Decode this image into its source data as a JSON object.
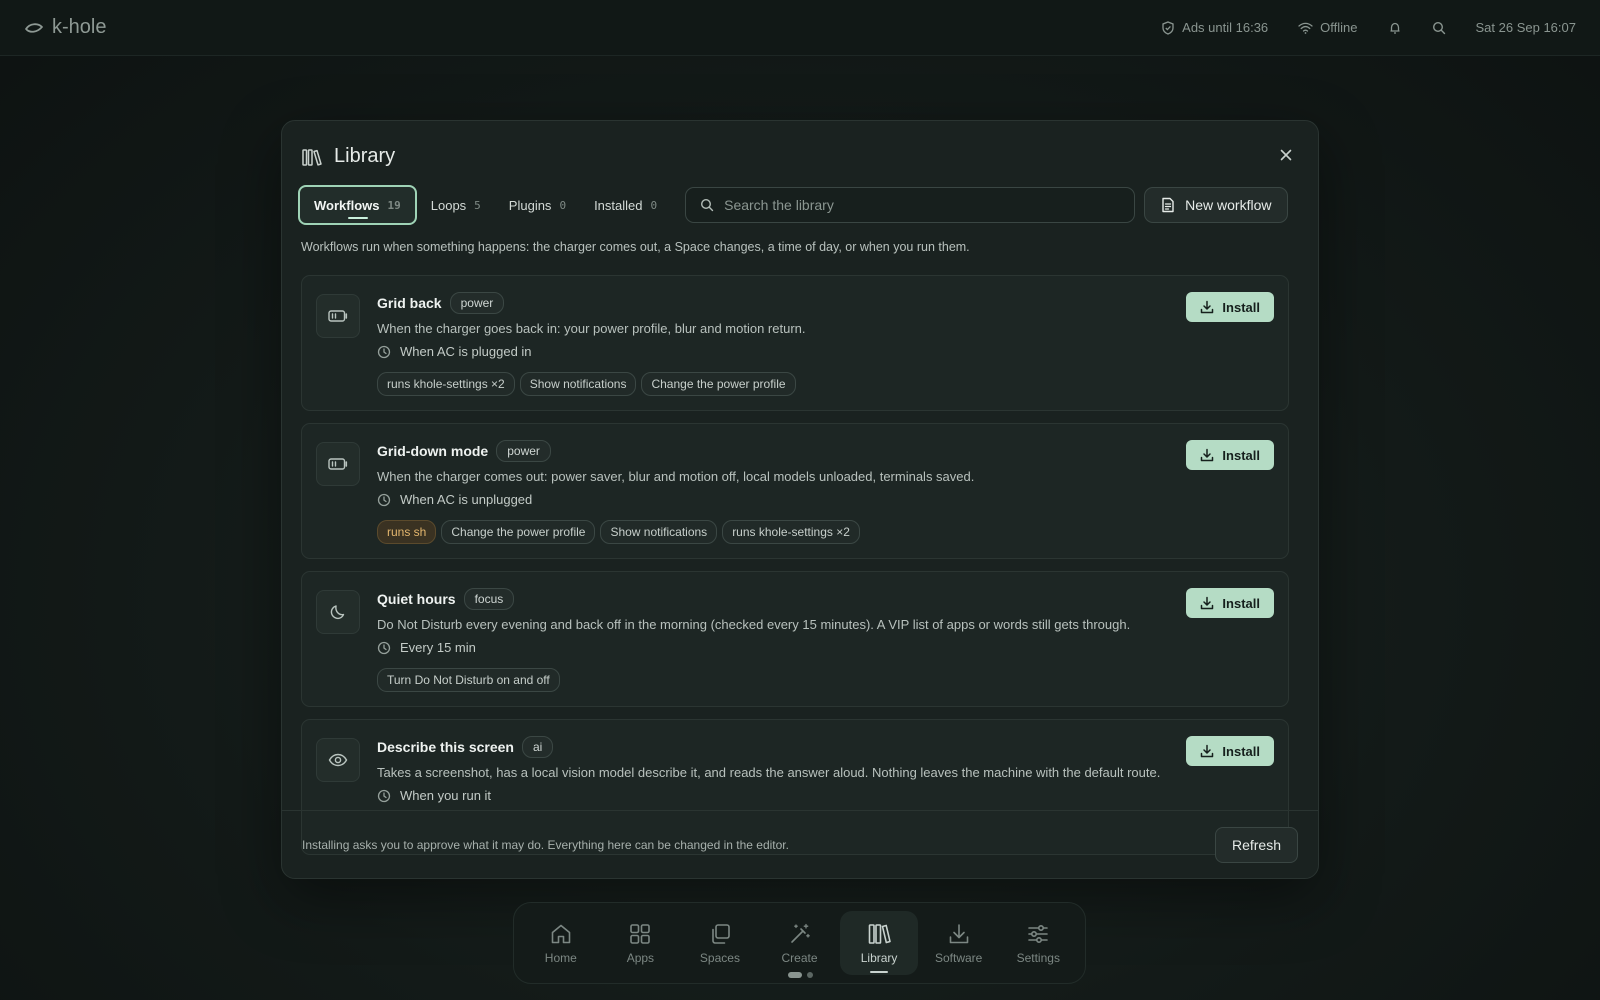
{
  "topbar": {
    "brand": "k-hole",
    "ads": "Ads until 16:36",
    "network": "Offline",
    "datetime": "Sat 26 Sep 16:07"
  },
  "dialog": {
    "title": "Library",
    "tabs": [
      {
        "label": "Workflows",
        "count": "19",
        "active": true
      },
      {
        "label": "Loops",
        "count": "5"
      },
      {
        "label": "Plugins",
        "count": "0"
      },
      {
        "label": "Installed",
        "count": "0"
      }
    ],
    "search_placeholder": "Search the library",
    "new_button": "New workflow",
    "description": "Workflows run when something happens: the charger comes out, a Space changes, a time of day, or when you run them.",
    "install_label": "Install",
    "workflows": [
      {
        "title": "Grid back",
        "category": "power",
        "icon": "battery-icon",
        "description": "When the charger goes back in: your power profile, blur and motion return.",
        "trigger": "When AC is plugged in",
        "capabilities": [
          {
            "label": "runs khole-settings ×2"
          },
          {
            "label": "Show notifications"
          },
          {
            "label": "Change the power profile"
          }
        ]
      },
      {
        "title": "Grid-down mode",
        "category": "power",
        "icon": "battery-icon",
        "description": "When the charger comes out: power saver, blur and motion off, local models unloaded, terminals saved.",
        "trigger": "When AC is unplugged",
        "capabilities": [
          {
            "label": "runs sh",
            "warn": true
          },
          {
            "label": "Change the power profile"
          },
          {
            "label": "Show notifications"
          },
          {
            "label": "runs khole-settings ×2"
          }
        ]
      },
      {
        "title": "Quiet hours",
        "category": "focus",
        "icon": "moon-icon",
        "description": "Do Not Disturb every evening and back off in the morning (checked every 15 minutes). A VIP list of apps or words still gets through.",
        "trigger": "Every 15 min",
        "capabilities": [
          {
            "label": "Turn Do Not Disturb on and off"
          }
        ]
      },
      {
        "title": "Describe this screen",
        "category": "ai",
        "icon": "eye-icon",
        "description": "Takes a screenshot, has a local vision model describe it, and reads the answer aloud. Nothing leaves the machine with the default route.",
        "trigger": "When you run it",
        "capabilities": []
      }
    ],
    "footer_note": "Installing asks you to approve what it may do. Everything here can be changed in the editor.",
    "refresh_button": "Refresh"
  },
  "dock": [
    {
      "label": "Home",
      "icon": "home-icon"
    },
    {
      "label": "Apps",
      "icon": "apps-icon"
    },
    {
      "label": "Spaces",
      "icon": "spaces-icon"
    },
    {
      "label": "Create",
      "icon": "create-icon"
    },
    {
      "label": "Library",
      "icon": "library-icon",
      "active": true
    },
    {
      "label": "Software",
      "icon": "software-icon"
    },
    {
      "label": "Settings",
      "icon": "settings-icon"
    }
  ],
  "colors": {
    "accent": "#b5dcc5",
    "warn": "#e3b66e",
    "background": "#131a18"
  }
}
